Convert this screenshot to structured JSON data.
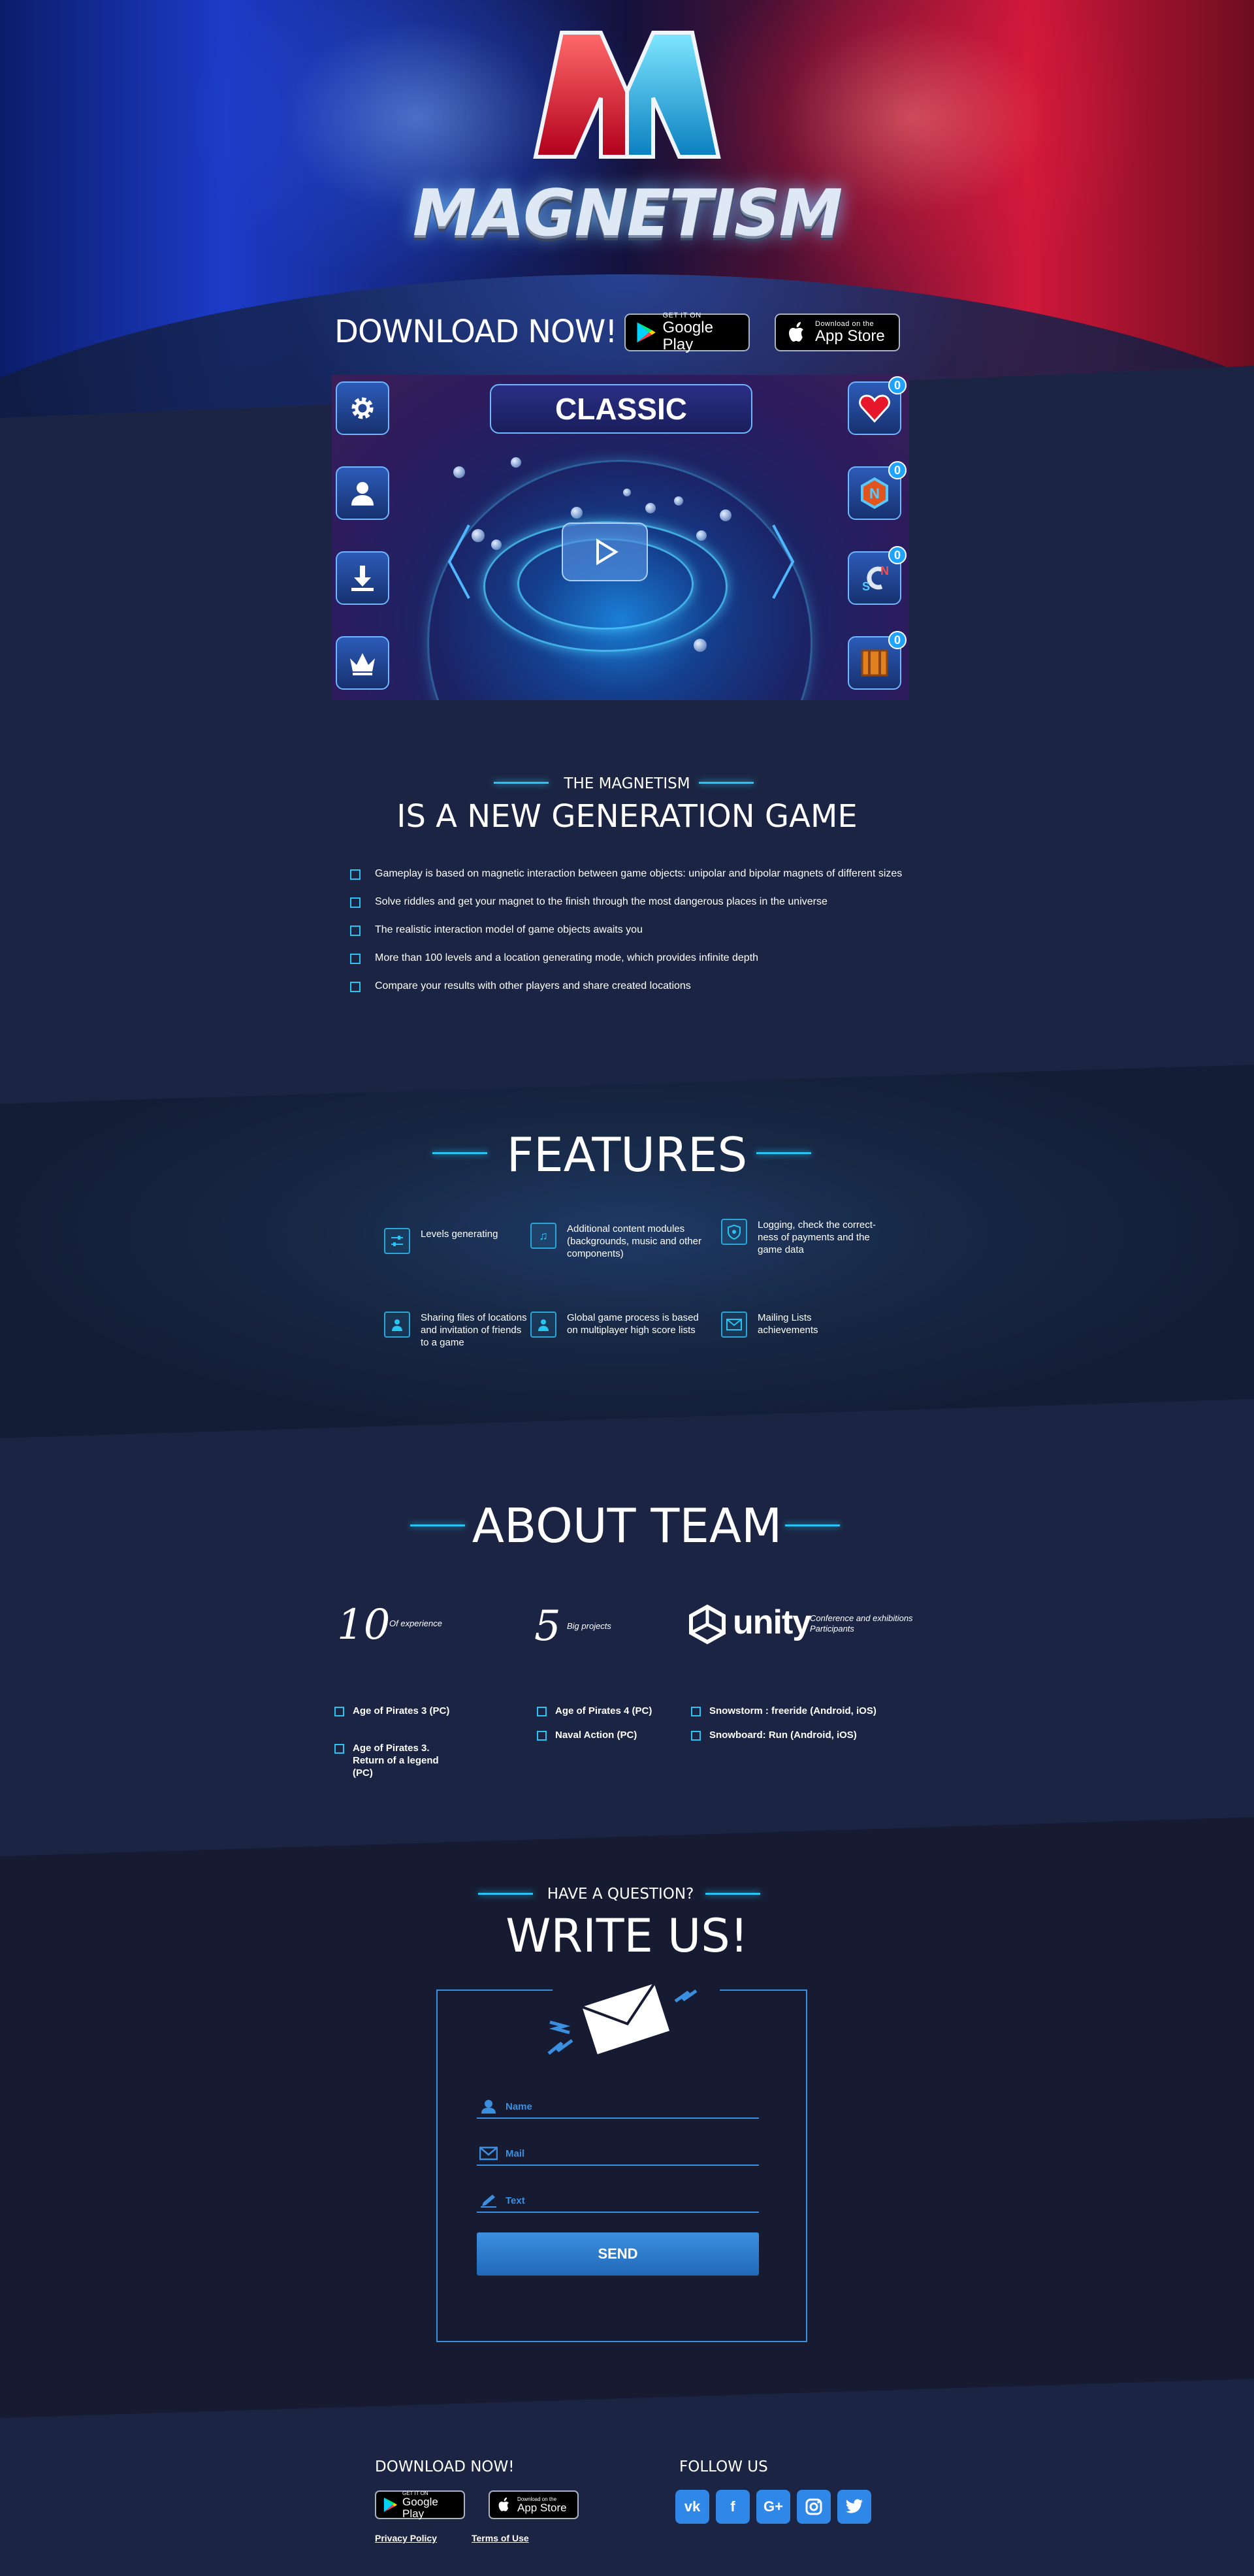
{
  "hero": {
    "logo_letter": "M",
    "logo_word": "MAGNETISM",
    "download_title": "DOWNLOAD NOW!",
    "google_play": {
      "small": "GET IT ON",
      "big": "Google Play"
    },
    "app_store": {
      "small": "Download on the",
      "big": "App Store"
    }
  },
  "game_screen": {
    "mode_title": "CLASSIC",
    "left_buttons": [
      "gear-icon",
      "user-icon",
      "download-icon",
      "crown-icon"
    ],
    "right_buttons": [
      {
        "icon": "heart-icon",
        "count": "0"
      },
      {
        "icon": "n-magnet-icon",
        "count": "0"
      },
      {
        "icon": "ns-magnet-icon",
        "count": "0"
      },
      {
        "icon": "crate-icon",
        "count": "0"
      }
    ]
  },
  "intro": {
    "kicker": "THE MAGNETISM",
    "title": "IS A NEW GENERATION GAME",
    "bullets": [
      "Gameplay is based on magnetic interaction between game objects: unipolar and bipolar magnets of different sizes",
      "Solve riddles and get your magnet to the finish through the most dangerous places in the universe",
      "The realistic interaction model of game objects awaits you",
      "More than 100 levels and a location generating mode, which provides infinite depth",
      "Compare your results with other players and share created locations"
    ]
  },
  "features": {
    "title": "FEATURES",
    "items": [
      {
        "icon": "sliders-icon",
        "text": "Levels generating"
      },
      {
        "icon": "music-note-icon",
        "text": "Additional content modules (backgrounds, music and other components)"
      },
      {
        "icon": "shield-icon",
        "text": "Logging, check the correct-ness of payments and the game data"
      },
      {
        "icon": "share-user-icon",
        "text": "Sharing files of locations and invitation of friends to a game"
      },
      {
        "icon": "user-icon",
        "text": "Global game process is based on multiplayer high score lists"
      },
      {
        "icon": "mail-icon",
        "text": "Mailing Lists achievements"
      }
    ]
  },
  "team": {
    "title": "ABOUT TEAM",
    "stats": [
      {
        "num": "10",
        "label": "Of experience"
      },
      {
        "num": "5",
        "label": "Big projects"
      }
    ],
    "unity": {
      "word": "unity",
      "label": "Conference and exhibitions Participants"
    },
    "col1": [
      "Age of Pirates 3 (PC)",
      "Age of Pirates 3. Return of a legend (PC)"
    ],
    "col2": [
      "Age of Pirates 4 (PC)",
      "Naval Action (PC)"
    ],
    "col3": [
      "Snowstorm : freeride (Android, iOS)",
      "Snowboard: Run (Android, iOS)"
    ]
  },
  "contact": {
    "kicker": "HAVE A QUESTION?",
    "title": "WRITE US!",
    "name_placeholder": "Name",
    "mail_placeholder": "Mail",
    "text_placeholder": "Text",
    "send_label": "SEND"
  },
  "footer": {
    "download_title": "DOWNLOAD NOW!",
    "follow_title": "FOLLOW US",
    "google_play": {
      "small": "GET IT ON",
      "big": "Google Play"
    },
    "app_store": {
      "small": "Download on the",
      "big": "App Store"
    },
    "social": [
      {
        "icon": "vk-icon",
        "glyph": "vk"
      },
      {
        "icon": "facebook-icon",
        "glyph": "f"
      },
      {
        "icon": "google-plus-icon",
        "glyph": "G+"
      },
      {
        "icon": "instagram-icon",
        "glyph": ""
      },
      {
        "icon": "twitter-icon",
        "glyph": ""
      }
    ],
    "privacy": "Privacy Policy",
    "terms": "Terms of Use"
  },
  "colors": {
    "page_bg": "#1b2442",
    "accent_cyan": "#29c4f2",
    "form_blue": "#3a8fe0",
    "social_blue": "#2f87e8"
  }
}
